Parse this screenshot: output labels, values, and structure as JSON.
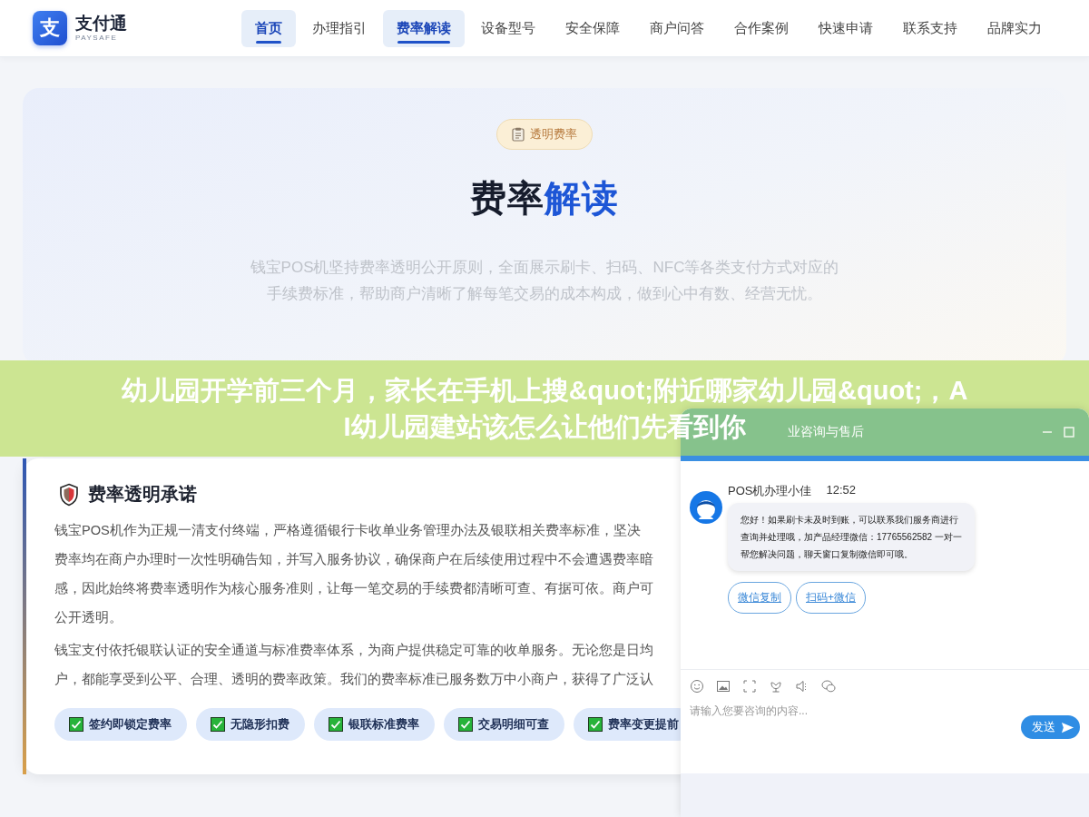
{
  "header": {
    "logo": {
      "mark": "支",
      "name": "支付通",
      "tagline": "PAYSAFE"
    },
    "nav": [
      {
        "label": "首页",
        "selected": true
      },
      {
        "label": "办理指引",
        "selected": false
      },
      {
        "label": "费率解读",
        "selected": true
      },
      {
        "label": "设备型号",
        "selected": false
      },
      {
        "label": "安全保障",
        "selected": false
      },
      {
        "label": "商户问答",
        "selected": false
      },
      {
        "label": "合作案例",
        "selected": false
      },
      {
        "label": "快速申请",
        "selected": false
      },
      {
        "label": "联系支持",
        "selected": false
      },
      {
        "label": "品牌实力",
        "selected": false
      }
    ]
  },
  "hero": {
    "badge": "透明费率",
    "title": {
      "text": "费率",
      "highlight": "解读"
    },
    "description": "钱宝POS机坚持费率透明公开原则，全面展示刷卡、扫码、NFC等各类支付方式对应的手续费标准，帮助商户清晰了解每笔交易的成本构成，做到心中有数、经营无忧。"
  },
  "banner": {
    "lines": [
      "幼儿园开学前三个月，家长在手机上搜&quot;附近哪家幼儿园&quot;，A",
      "I幼儿园建站该怎么让他们先看到你"
    ]
  },
  "promise_card": {
    "title": "费率透明承诺",
    "paragraphs": [
      [
        "钱宝POS机作为正规一清支付终端，严格遵循银行卡收单业务管理办法及银联相关费率标准，坚决",
        "费率均在商户办理时一次性明确告知，并写入服务协议，确保商户在后续使用过程中不会遭遇费率暗",
        "感，因此始终将费率透明作为核心服务准则，让每一笔交易的手续费都清晰可查、有据可依。商户可",
        "公开透明。"
      ],
      [
        "钱宝支付依托银联认证的安全通道与标准费率体系，为商户提供稳定可靠的收单服务。无论您是日均",
        "户，都能享受到公平、合理、透明的费率政策。我们的费率标准已服务数万中小商户，获得了广泛认"
      ]
    ],
    "tags": [
      {
        "label": "签约即锁定费率",
        "checked": true
      },
      {
        "label": "无隐形扣费",
        "checked": true
      },
      {
        "label": "银联标准费率",
        "checked": true
      },
      {
        "label": "交易明细可查",
        "checked": true
      },
      {
        "label": "费率变更提前",
        "checked": true
      }
    ]
  },
  "chat": {
    "title": "业咨询与售后",
    "message": {
      "sender": "POS机办理小佳",
      "time": "12:52",
      "text": "您好！如果刷卡未及时到账，可以联系我们服务商进行查询并处理哦，加产品经理微信：17765562582 一对一帮您解决问题，聊天窗口复制微信即可哦。",
      "actions": [
        "微信复制",
        "扫码+微信"
      ]
    },
    "input": {
      "placeholder": "请输入您要咨询的内容..."
    },
    "send": "发送"
  }
}
